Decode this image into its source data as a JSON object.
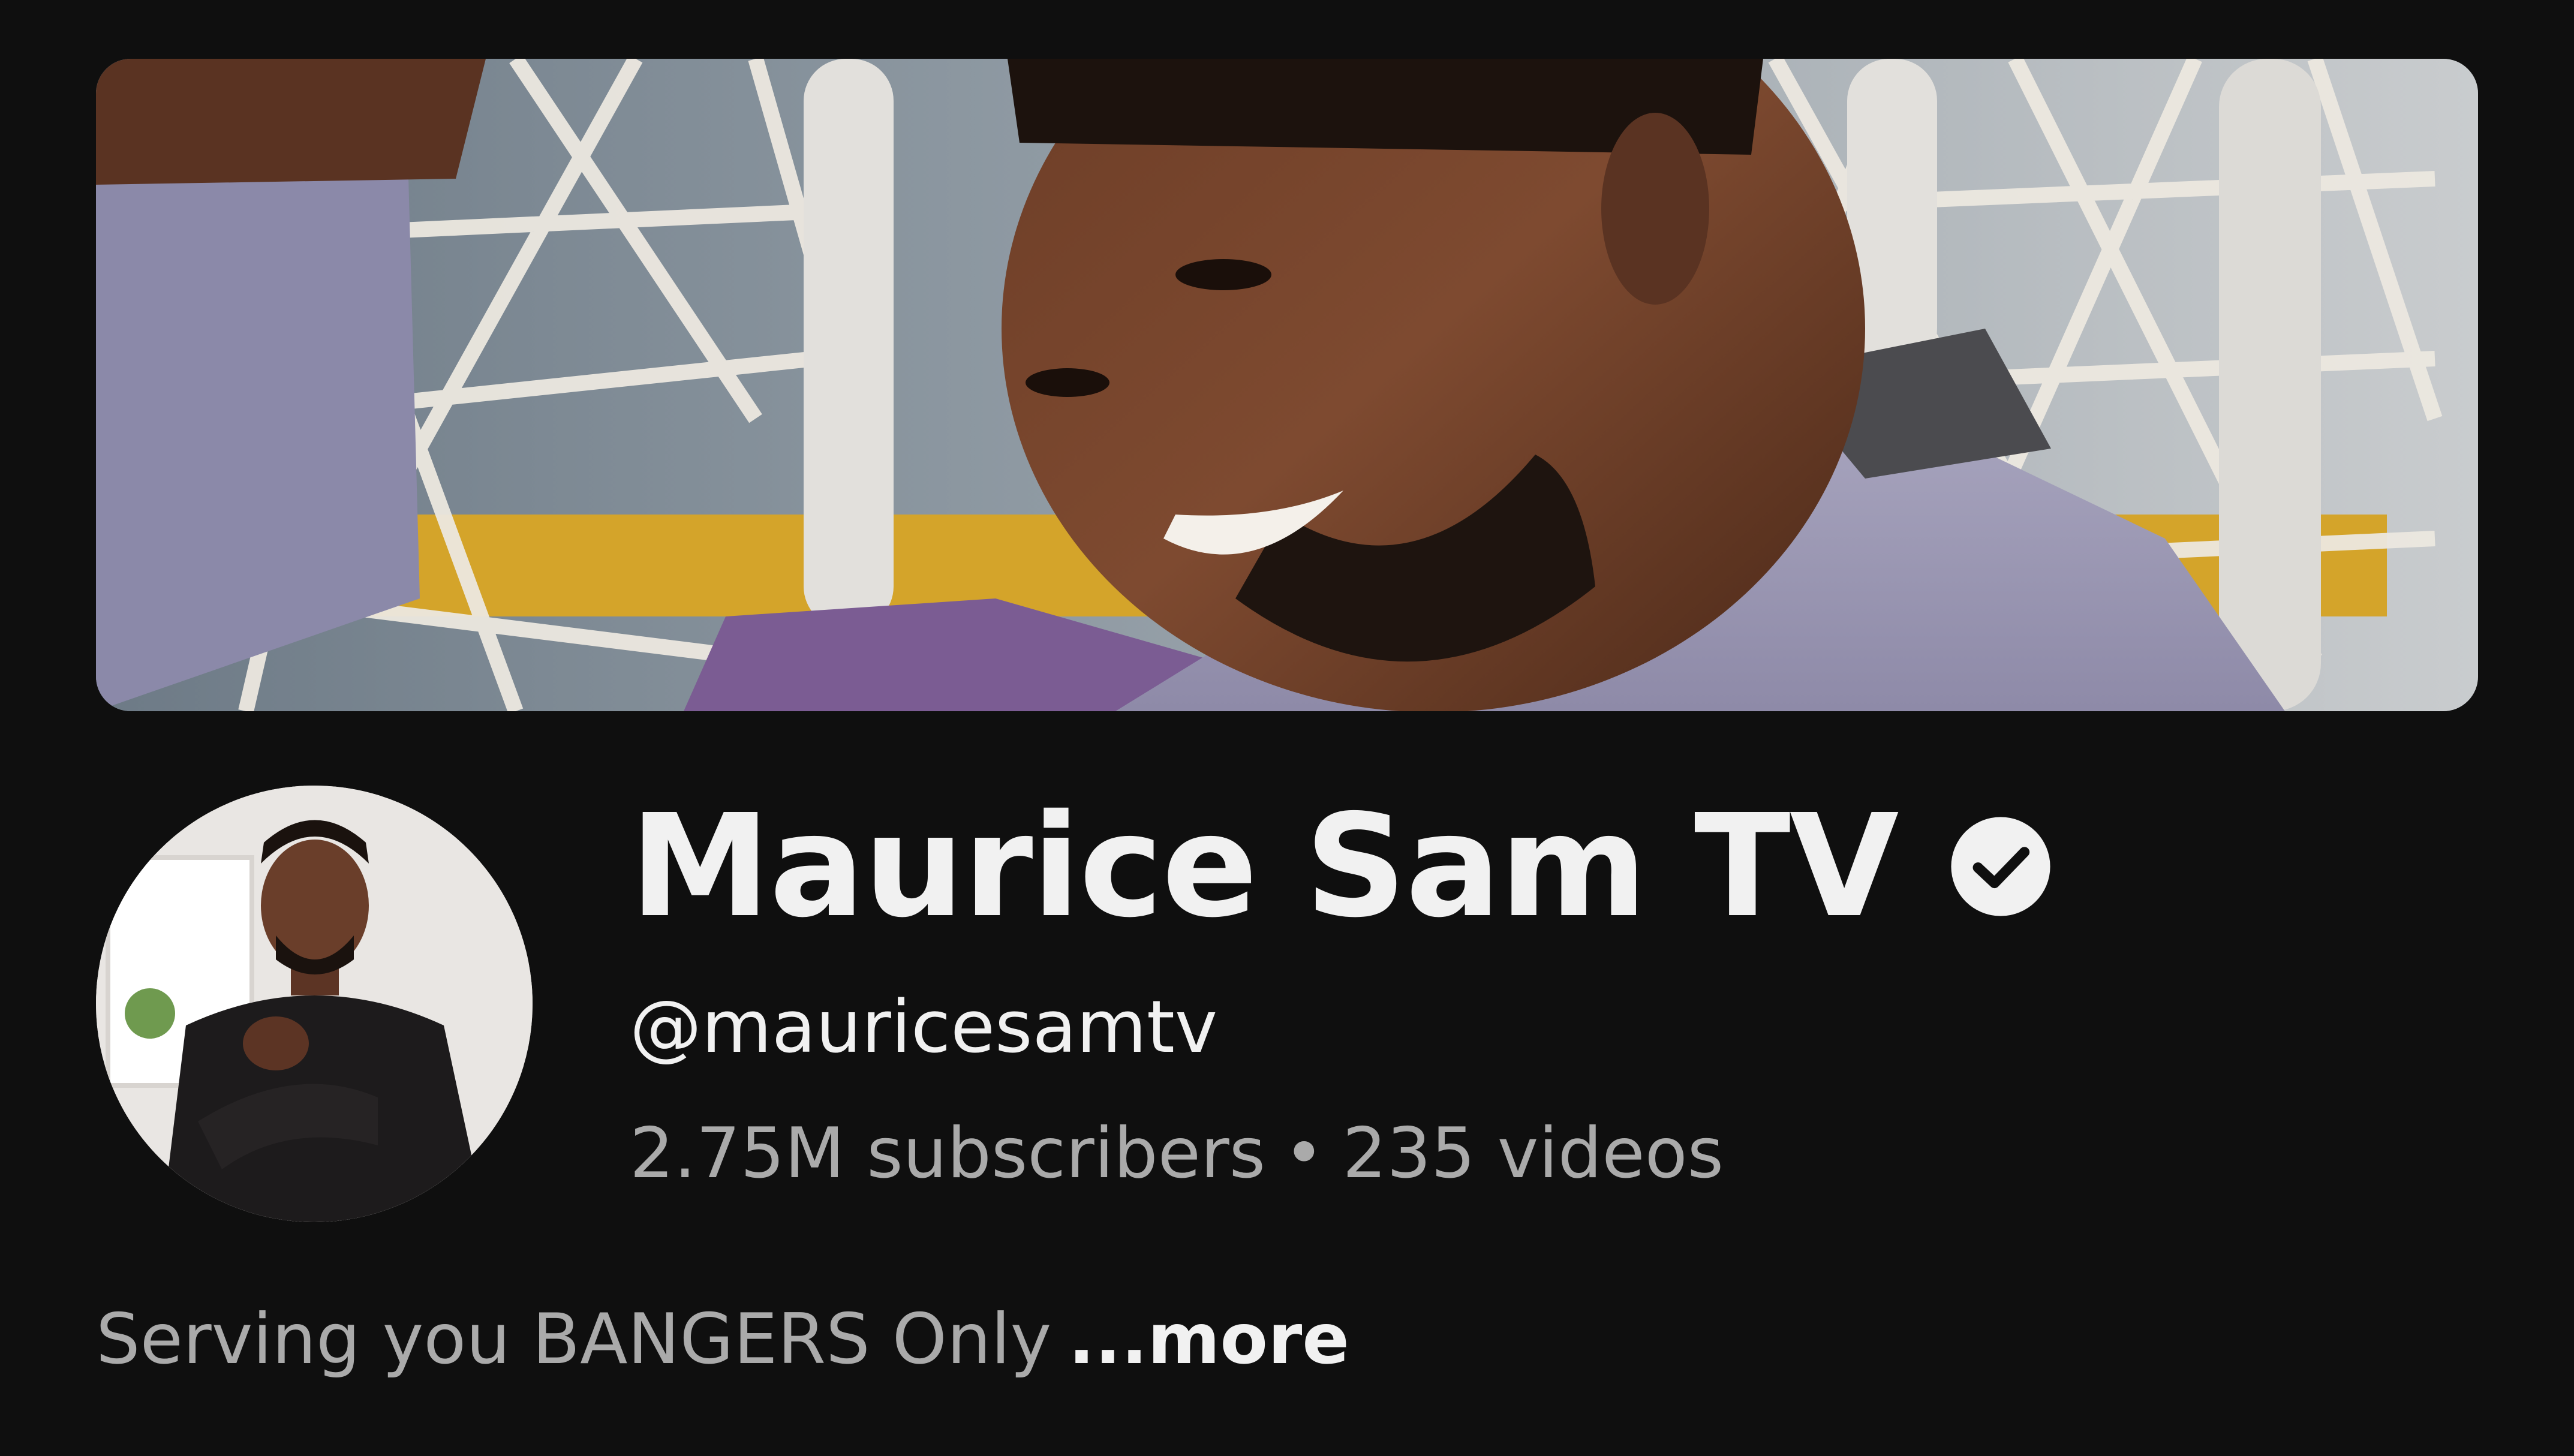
{
  "channel": {
    "name": "Maurice Sam TV",
    "handle": "@mauricesamtv",
    "subscribers": "2.75M subscribers",
    "separator": "•",
    "videos": "235 videos",
    "description": "Serving you BANGERS Only",
    "more_label": "...more",
    "verified_icon": "verified-check-icon"
  },
  "colors": {
    "background": "#0f0f0f",
    "primary_text": "#f1f1f1",
    "secondary_text": "#aaaaaa"
  }
}
